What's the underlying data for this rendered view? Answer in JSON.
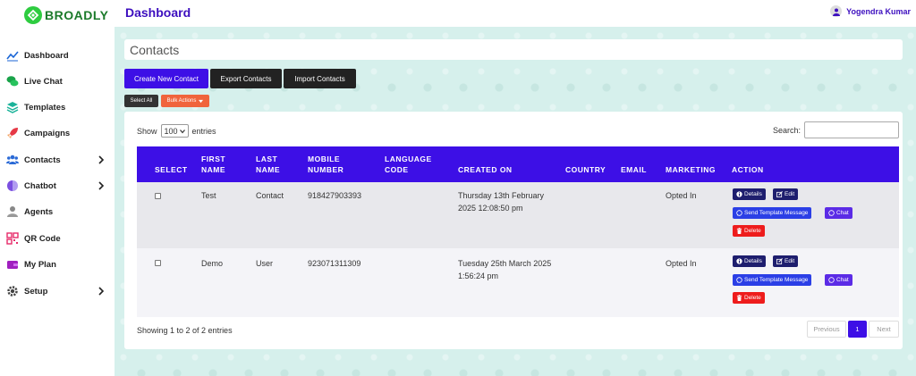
{
  "app": {
    "name": "BROADLY"
  },
  "header": {
    "title": "Dashboard",
    "user_name": "Yogendra Kumar"
  },
  "sidebar": {
    "items": [
      {
        "label": "Dashboard",
        "icon": "chart-line-icon"
      },
      {
        "label": "Live Chat",
        "icon": "chat-bubbles-icon"
      },
      {
        "label": "Templates",
        "icon": "layers-icon"
      },
      {
        "label": "Campaigns",
        "icon": "rocket-icon"
      },
      {
        "label": "Contacts",
        "icon": "users-icon",
        "has_submenu": true
      },
      {
        "label": "Chatbot",
        "icon": "brain-icon",
        "has_submenu": true
      },
      {
        "label": "Agents",
        "icon": "agent-icon"
      },
      {
        "label": "QR Code",
        "icon": "qr-code-icon"
      },
      {
        "label": "My Plan",
        "icon": "wallet-icon"
      },
      {
        "label": "Setup",
        "icon": "gear-icon",
        "has_submenu": true
      }
    ]
  },
  "page": {
    "section_title": "Contacts",
    "buttons": {
      "create": "Create New Contact",
      "export": "Export Contacts",
      "import": "Import Contacts",
      "select_all": "Select All",
      "bulk_actions": "Bulk Actions"
    },
    "table": {
      "show_label": "Show",
      "show_value": "100",
      "entries_label": "entries",
      "search_label": "Search:",
      "columns": [
        "SELECT",
        "FIRST NAME",
        "LAST NAME",
        "MOBILE NUMBER",
        "LANGUAGE CODE",
        "CREATED ON",
        "COUNTRY",
        "EMAIL",
        "MARKETING",
        "ACTION"
      ],
      "rows": [
        {
          "first": "Test",
          "last": "Contact",
          "mobile": "918427903393",
          "language": "",
          "created_line1": "Thursday 13th February",
          "created_line2": "2025 12:08:50 pm",
          "country": "",
          "email": "",
          "marketing": "Opted In"
        },
        {
          "first": "Demo",
          "last": "User",
          "mobile": "923071311309",
          "language": "",
          "created_line1": "Tuesday 25th March 2025",
          "created_line2": "1:56:24 pm",
          "country": "",
          "email": "",
          "marketing": "Opted In"
        }
      ],
      "actions": {
        "details": "Details",
        "edit": "Edit",
        "send_template": "Send Template Message",
        "chat": "Chat",
        "delete": "Delete"
      },
      "footer_info": "Showing 1 to 2 of 2 entries",
      "pagination": {
        "previous": "Previous",
        "current": "1",
        "next": "Next"
      }
    }
  },
  "colors": {
    "primary": "#3d0fe6",
    "title": "#3d0fbf",
    "danger": "#ee1c1c",
    "bulk": "#f0643c",
    "background": "#d6f0ec"
  }
}
